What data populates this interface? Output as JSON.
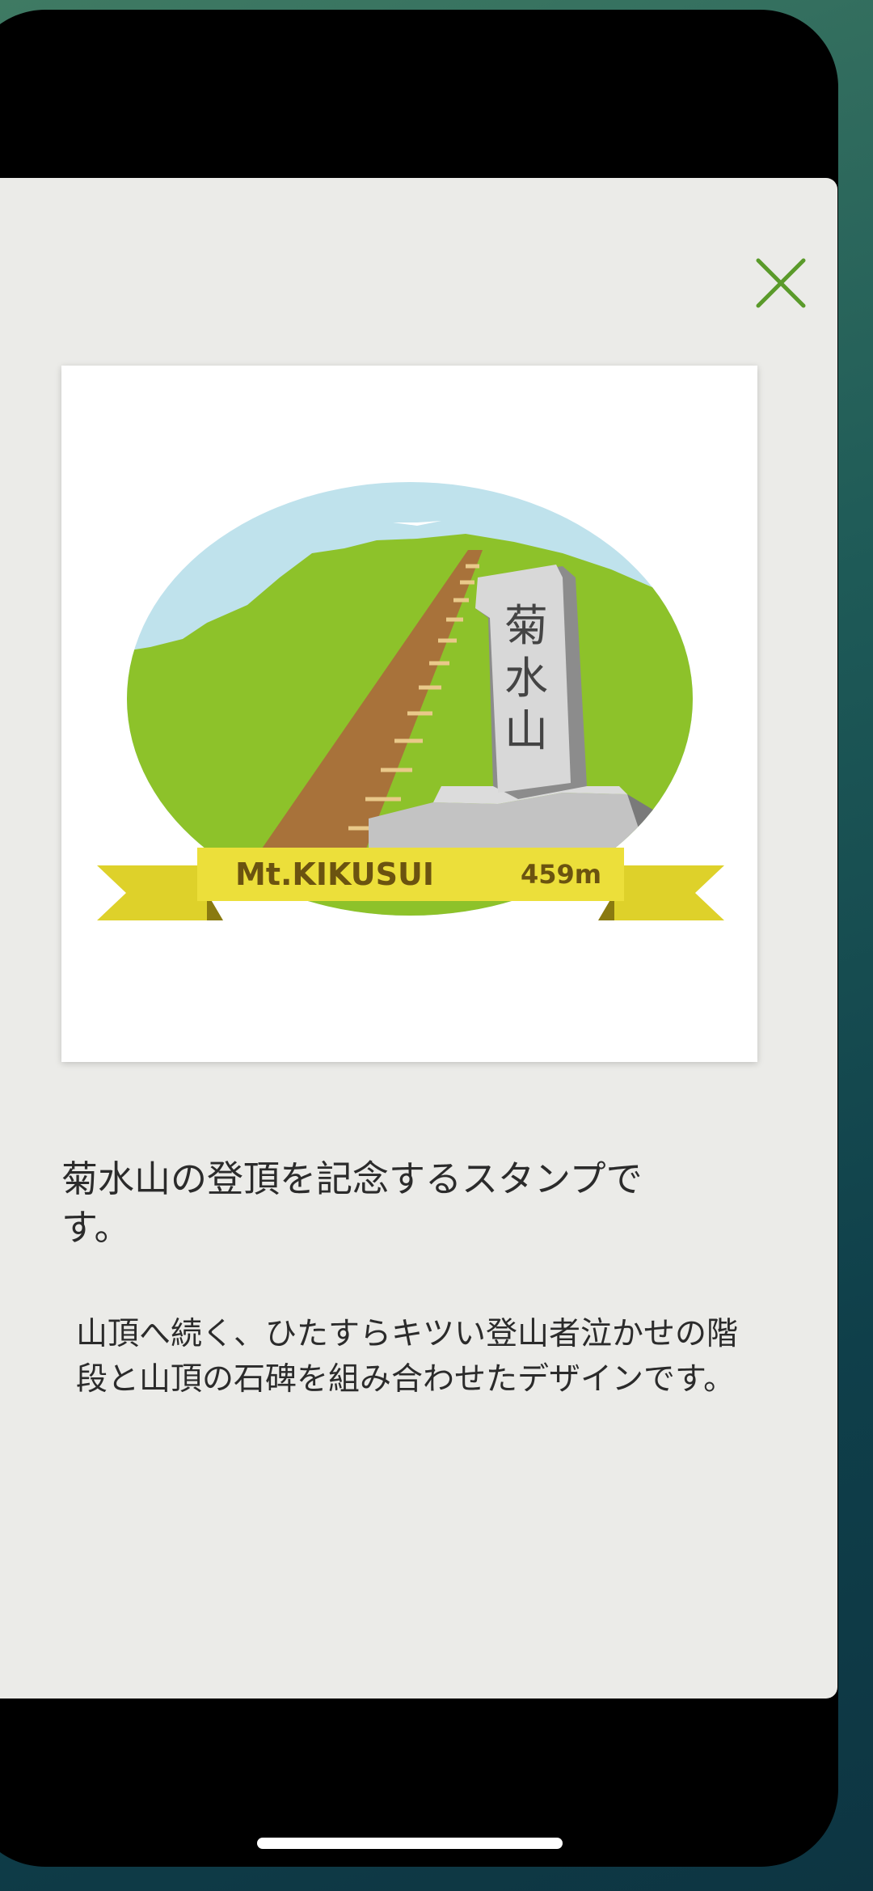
{
  "stamp": {
    "monument_text": [
      "菊",
      "水",
      "山"
    ],
    "banner_name": "Mt.KIKUSUI",
    "banner_elevation": "459m",
    "colors": {
      "sky": "#bfe2ec",
      "mountain": "#8dc22a",
      "stairs": "#a8723a",
      "rock": "#c3c3c3",
      "banner": "#ecdf3a",
      "banner_text": "#6b5310"
    }
  },
  "detail": {
    "title": "菊水山の登頂を記念するスタンプです。",
    "description": "山頂へ続く、ひたすらキツい登山者泣かせの階段と山頂の石碑を組み合わせたデザインです。"
  },
  "icons": {
    "close": "close-icon"
  },
  "accent_color": "#5a9a2a"
}
